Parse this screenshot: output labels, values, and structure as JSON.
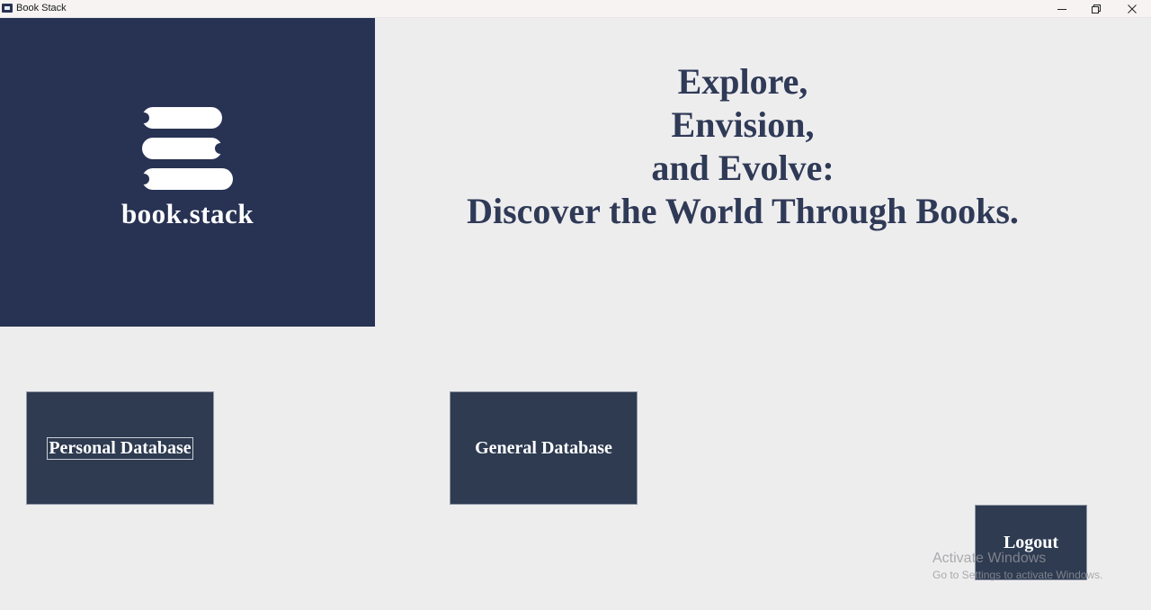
{
  "window": {
    "title": "Book Stack",
    "icon": "app-book-icon",
    "controls": [
      "minimize-icon",
      "restore-icon",
      "close-icon"
    ]
  },
  "logo": {
    "text": "book.stack",
    "icon": "book-stack-icon"
  },
  "headline": {
    "lines": [
      "Explore,",
      "Envision,",
      "and Evolve:",
      "Discover the World Through Books."
    ]
  },
  "buttons": {
    "personal": "Personal Database",
    "general": "General Database",
    "logout": "Logout"
  },
  "watermark": {
    "title": "Activate Windows",
    "subtitle": "Go to Settings to activate Windows."
  },
  "colors": {
    "brand_navy": "#283253",
    "tile": "#2e3b51",
    "headline_text": "#2f3a57",
    "background": "#eeedee"
  }
}
